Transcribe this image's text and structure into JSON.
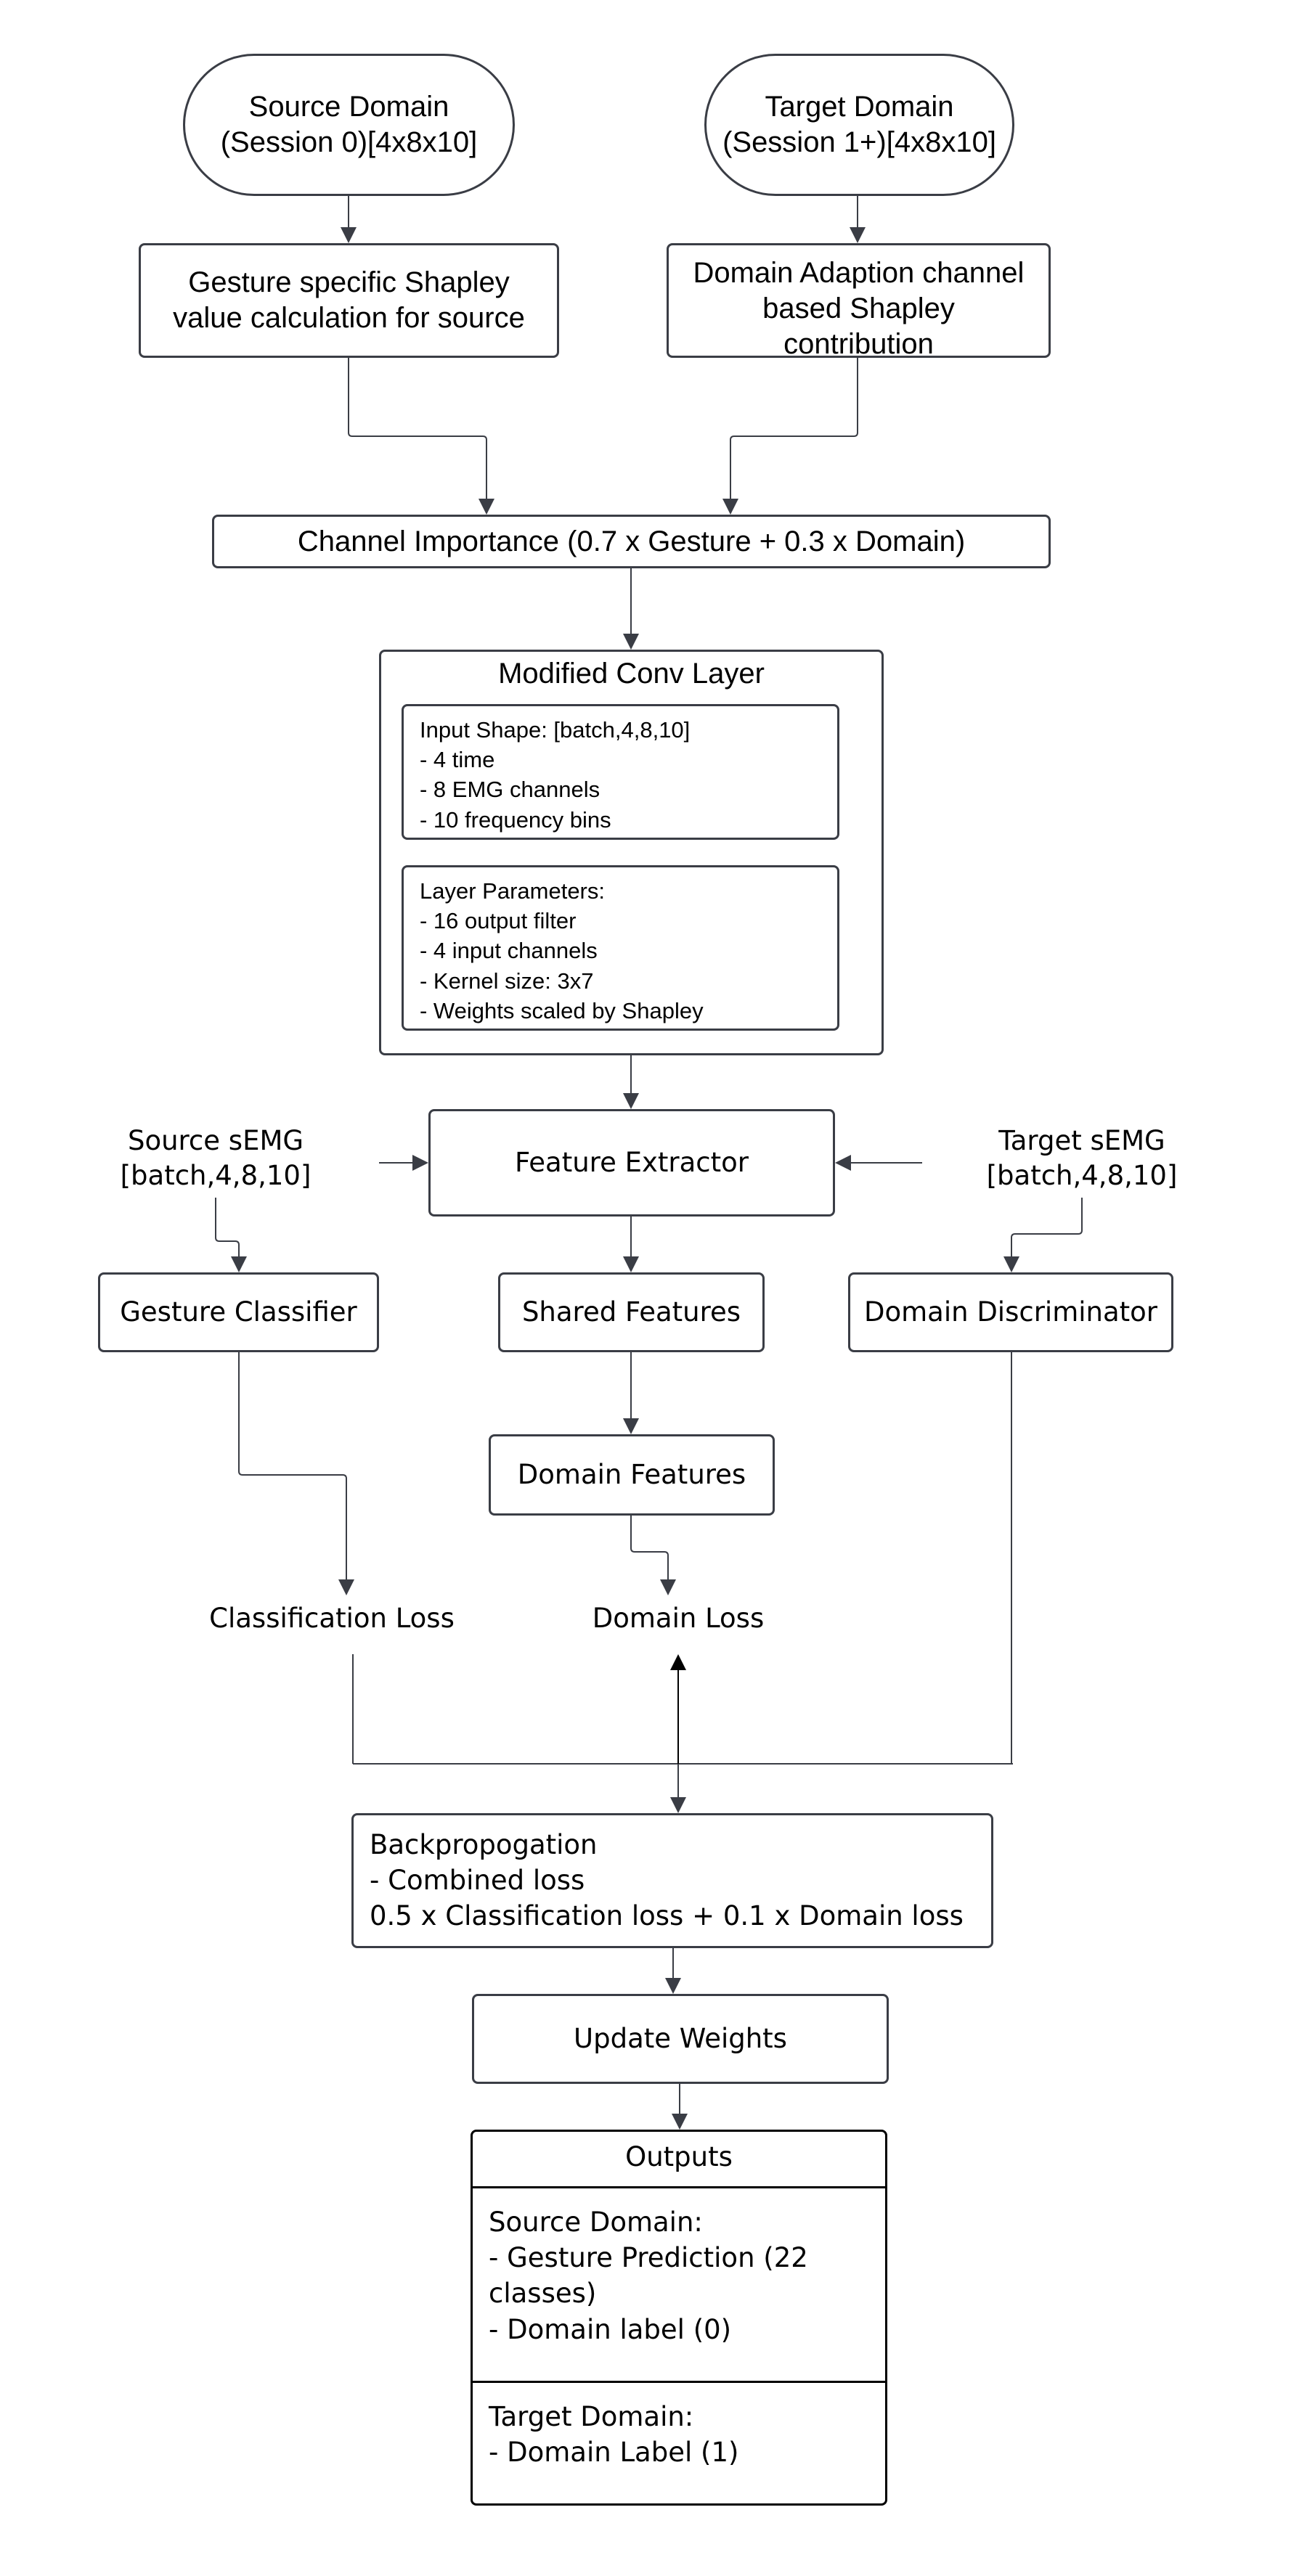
{
  "nodes": {
    "source_domain": [
      "Source Domain",
      "(Session 0)[4x8x10]"
    ],
    "target_domain": [
      "Target Domain",
      "(Session 1+)[4x8x10]"
    ],
    "gesture_shapley": [
      "Gesture specific Shapley",
      "value calculation for source"
    ],
    "domain_shapley": [
      "Domain Adaption channel",
      "based Shapley",
      "contribution"
    ],
    "channel_importance": "Channel Importance (0.7 x Gesture + 0.3 x Domain)",
    "conv_layer": {
      "title": "Modified Conv Layer",
      "input_shape": [
        "Input Shape: [batch,4,8,10]",
        "- 4 time",
        "- 8 EMG channels",
        "- 10 frequency bins"
      ],
      "layer_params": [
        "Layer Parameters:",
        "- 16 output filter",
        "- 4 input channels",
        "- Kernel size: 3x7",
        "- Weights scaled by Shapley"
      ]
    },
    "source_semg": [
      "Source sEMG",
      "[batch,4,8,10]"
    ],
    "target_semg": [
      "Target sEMG",
      "[batch,4,8,10]"
    ],
    "feature_extractor": "Feature Extractor",
    "gesture_classifier": "Gesture Classifier",
    "shared_features": "Shared Features",
    "domain_discriminator": "Domain Discriminator",
    "domain_features": "Domain Features",
    "classification_loss": "Classification Loss",
    "domain_loss": "Domain Loss",
    "backprop": [
      "Backpropogation",
      "- Combined loss",
      "0.5 x Classification loss + 0.1 x Domain loss"
    ],
    "update_weights": "Update Weights",
    "outputs": {
      "title": "Outputs",
      "source": [
        "Source Domain:",
        "- Gesture Prediction (22",
        "classes)",
        "- Domain label (0)"
      ],
      "target": [
        "Target Domain:",
        "- Domain Label (1)"
      ]
    }
  },
  "colors": {
    "stroke": "#3a3d45",
    "background": "#ffffff"
  }
}
